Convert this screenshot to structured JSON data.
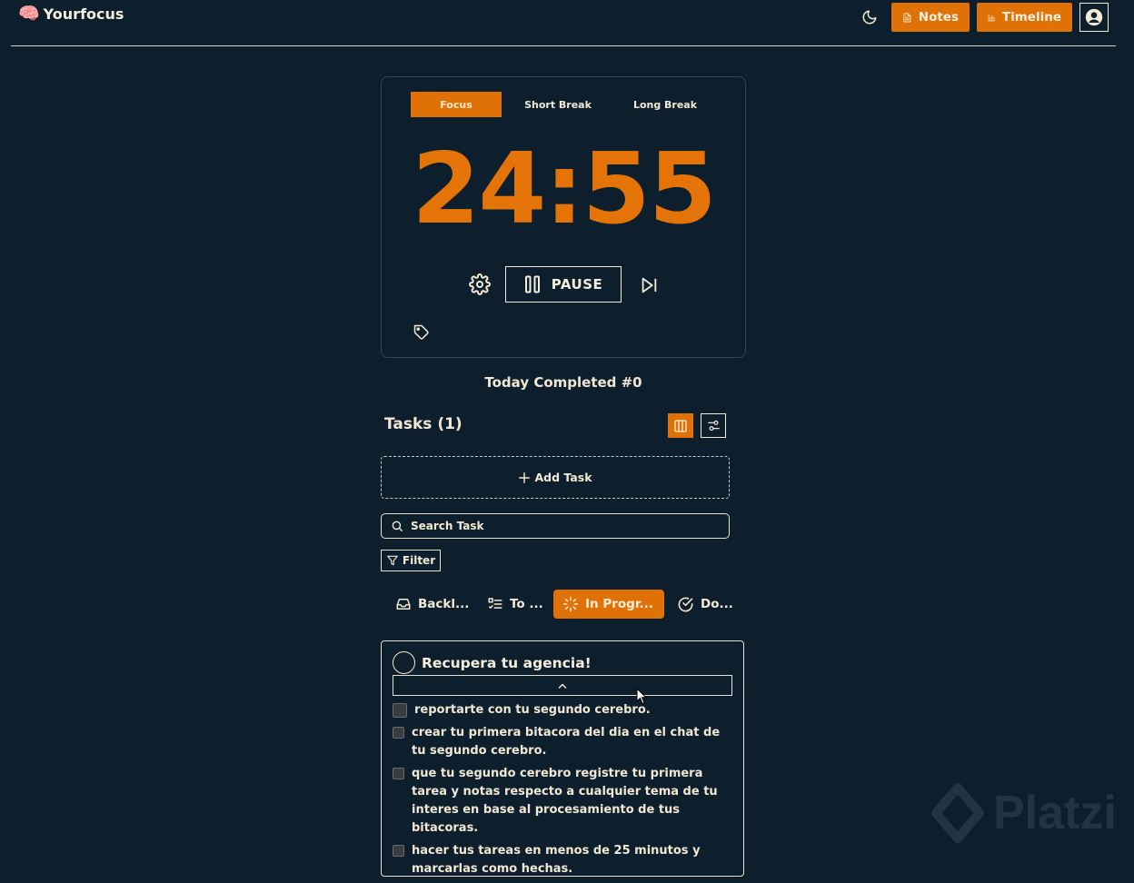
{
  "app": {
    "brand_icon": "🧠",
    "brand_name": "Yourfocus"
  },
  "header": {
    "theme_icon": "moon-icon",
    "notes_label": "Notes",
    "timeline_label": "Timeline",
    "profile_icon": "user-circle-icon"
  },
  "colors": {
    "accent": "#e07106",
    "background": "#0d1f2d",
    "text": "#f3ead6"
  },
  "timer": {
    "tabs": [
      {
        "label": "Focus",
        "active": true
      },
      {
        "label": "Short Break",
        "active": false
      },
      {
        "label": "Long Break",
        "active": false
      }
    ],
    "time": "24:55",
    "pause_label": "PAUSE"
  },
  "stats": {
    "completed_text": "Today Completed #0"
  },
  "tasks": {
    "title": "Tasks (1)",
    "add_label": "Add Task",
    "search_placeholder": "Search Task",
    "filter_label": "Filter",
    "status_tabs": [
      {
        "label": "Backl...",
        "icon": "inbox-icon",
        "active": false
      },
      {
        "label": "To ...",
        "icon": "list-check-icon",
        "active": false
      },
      {
        "label": "In Progr...",
        "icon": "loader-icon",
        "active": true
      },
      {
        "label": "Do...",
        "icon": "check-circle-icon",
        "active": false
      }
    ],
    "card": {
      "title": "Recupera tu agencia!",
      "subtasks": [
        "reportarte con tu segundo cerebro.",
        "crear tu primera bitacora del dia en el chat de tu segundo cerebro.",
        "que tu segundo cerebro registre tu primera tarea y notas respecto a cualquier tema de tu interes en base al procesamiento de tus bitacoras.",
        "hacer tus tareas en menos de 25 minutos y marcarlas como hechas."
      ]
    }
  },
  "watermark": {
    "text": "Platzi"
  }
}
